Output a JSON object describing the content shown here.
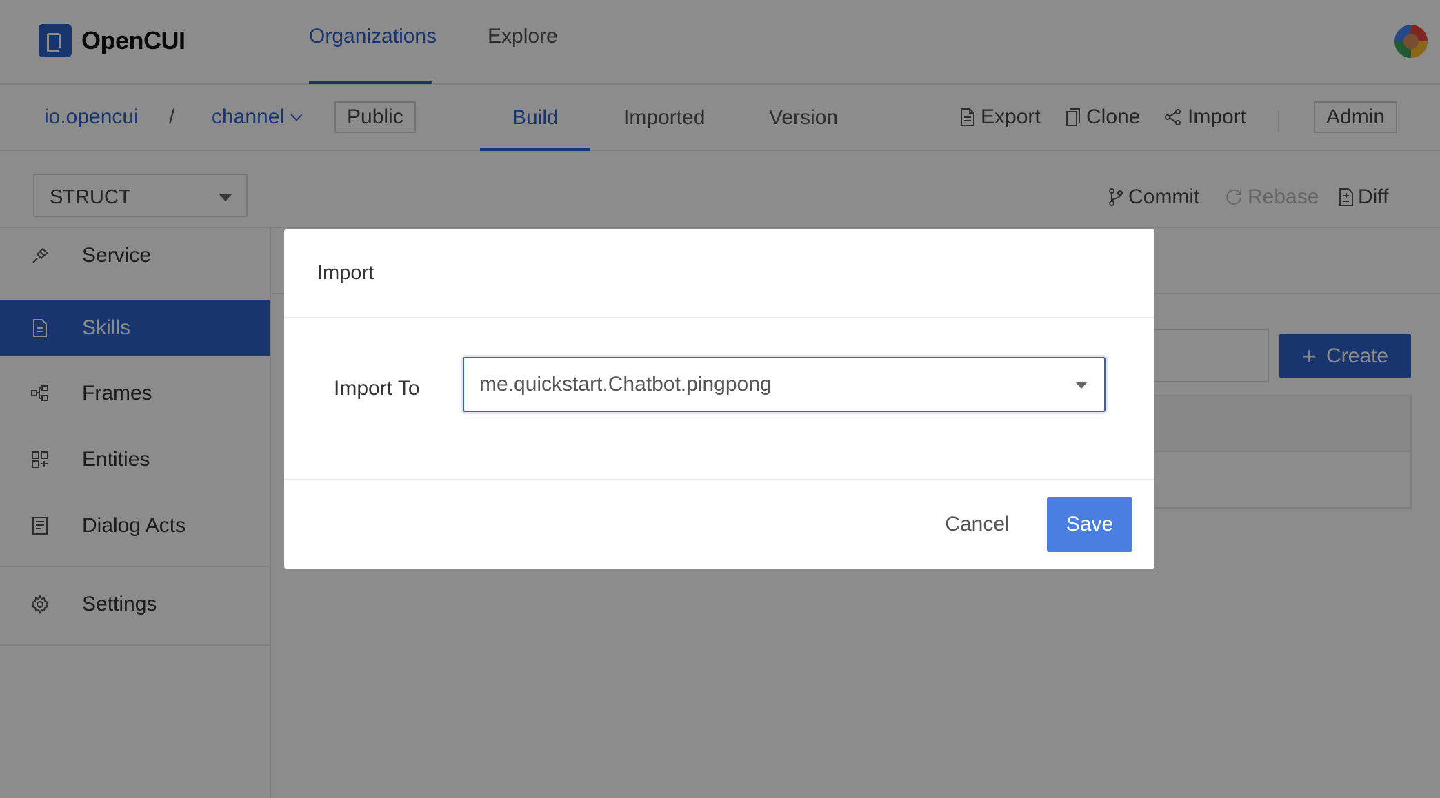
{
  "app": {
    "name": "OpenCUI"
  },
  "topnav": {
    "organizations": "Organizations",
    "explore": "Explore"
  },
  "subbar": {
    "org": "io.opencui",
    "separator": "/",
    "project": "channel",
    "visibility": "Public",
    "tabs": {
      "build": "Build",
      "imported": "Imported",
      "version": "Version"
    },
    "actions": {
      "export": "Export",
      "clone": "Clone",
      "import": "Import",
      "admin": "Admin"
    }
  },
  "toolbar": {
    "type_select": "STRUCT",
    "commit": "Commit",
    "rebase": "Rebase",
    "diff": "Diff"
  },
  "sidebar": {
    "items": [
      {
        "label": "Service",
        "icon": "plug-icon"
      },
      {
        "label": "Skills",
        "icon": "document-icon",
        "active": true
      },
      {
        "label": "Frames",
        "icon": "frames-icon"
      },
      {
        "label": "Entities",
        "icon": "entities-icon"
      },
      {
        "label": "Dialog Acts",
        "icon": "dialog-acts-icon"
      },
      {
        "label": "Settings",
        "icon": "gear-icon"
      }
    ]
  },
  "main": {
    "create_label": "Create"
  },
  "modal": {
    "title": "Import",
    "field_label": "Import To",
    "selected_value": "me.quickstart.Chatbot.pingpong",
    "cancel_label": "Cancel",
    "save_label": "Save"
  },
  "colors": {
    "primary": "#2d62c8",
    "save_button": "#4a7fe0",
    "overlay": "rgba(0,0,0,0.45)"
  }
}
